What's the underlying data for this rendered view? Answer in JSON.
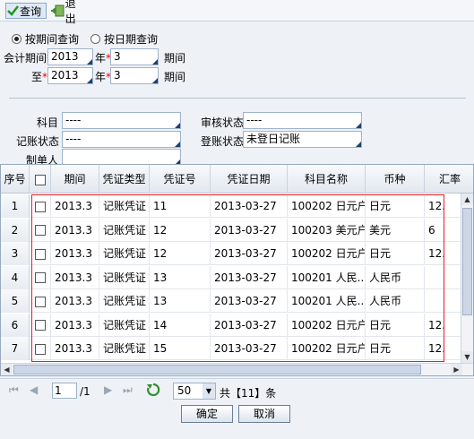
{
  "toolbar": {
    "query_label": "查询",
    "exit_label": "退出"
  },
  "radios": {
    "by_period": "按期间查询",
    "by_date": "按日期查询"
  },
  "period": {
    "label_from": "会计期间",
    "label_to": "至",
    "from_year": "2013",
    "from_period": "3",
    "to_year": "2013",
    "to_period": "3",
    "year_unit": "年",
    "period_unit": "期间",
    "required_mark": "*"
  },
  "filters": {
    "subject_label": "科目",
    "subject_value": "----",
    "audit_label": "审核状态",
    "audit_value": "----",
    "post_label": "记账状态",
    "post_value": "----",
    "book_label": "登账状态",
    "book_value": "未登日记账",
    "maker_label": "制单人",
    "maker_value": ""
  },
  "table": {
    "headers": [
      "序号",
      "",
      "期间",
      "凭证类型",
      "凭证号",
      "凭证日期",
      "科目名称",
      "币种",
      "汇率"
    ],
    "rows": [
      {
        "no": "1",
        "period": "2013.3",
        "type": "记账凭证",
        "num": "11",
        "date": "2013-03-27",
        "subject": "100202 日元户",
        "currency": "日元",
        "rate": "12."
      },
      {
        "no": "2",
        "period": "2013.3",
        "type": "记账凭证",
        "num": "12",
        "date": "2013-03-27",
        "subject": "100203 美元户",
        "currency": "美元",
        "rate": "6"
      },
      {
        "no": "3",
        "period": "2013.3",
        "type": "记账凭证",
        "num": "12",
        "date": "2013-03-27",
        "subject": "100202 日元户",
        "currency": "日元",
        "rate": "12."
      },
      {
        "no": "4",
        "period": "2013.3",
        "type": "记账凭证",
        "num": "13",
        "date": "2013-03-27",
        "subject": "100201 人民...",
        "currency": "人民币",
        "rate": ""
      },
      {
        "no": "5",
        "period": "2013.3",
        "type": "记账凭证",
        "num": "13",
        "date": "2013-03-27",
        "subject": "100201 人民...",
        "currency": "人民币",
        "rate": ""
      },
      {
        "no": "6",
        "period": "2013.3",
        "type": "记账凭证",
        "num": "14",
        "date": "2013-03-27",
        "subject": "100202 日元户",
        "currency": "日元",
        "rate": "12."
      },
      {
        "no": "7",
        "period": "2013.3",
        "type": "记账凭证",
        "num": "15",
        "date": "2013-03-27",
        "subject": "100202 日元户",
        "currency": "日元",
        "rate": "12."
      }
    ]
  },
  "pager": {
    "page": "1",
    "total_pages": "/1",
    "page_size": "50",
    "total_text": "共【11】条"
  },
  "buttons": {
    "ok": "确定",
    "cancel": "取消"
  },
  "colors": {
    "highlight": "#e0202a",
    "header_bg": "#e2e8ef",
    "accent": "#1d3f6e"
  }
}
